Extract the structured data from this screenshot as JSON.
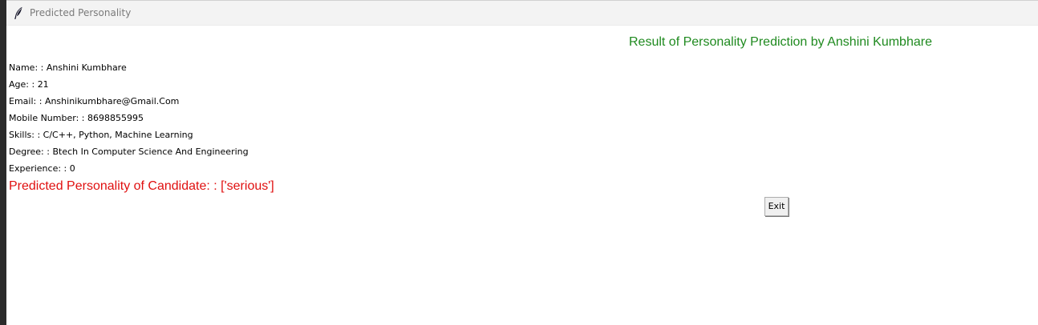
{
  "window": {
    "title": "Predicted Personality",
    "icon": "feather-icon"
  },
  "heading": "Result of Personality Prediction by Anshini Kumbhare",
  "fields": [
    {
      "label": "Name: : ",
      "value": "Anshini Kumbhare"
    },
    {
      "label": "Age: : ",
      "value": "21"
    },
    {
      "label": "Email: : ",
      "value": "Anshinikumbhare@Gmail.Com"
    },
    {
      "label": "Mobile Number: : ",
      "value": "8698855995"
    },
    {
      "label": "Skills: : ",
      "value": "C/C++, Python, Machine Learning"
    },
    {
      "label": "Degree: : ",
      "value": "Btech In Computer Science And Engineering"
    },
    {
      "label": "Experience: : ",
      "value": "0"
    }
  ],
  "prediction": {
    "label": "Predicted Personality of Candidate: : ",
    "value": "['serious']"
  },
  "exit_button": {
    "label": "Exit"
  },
  "colors": {
    "heading": "#1f8a1f",
    "prediction": "#e01010",
    "titlebar": "#f3f3f3",
    "window_bg": "#ffffff"
  }
}
